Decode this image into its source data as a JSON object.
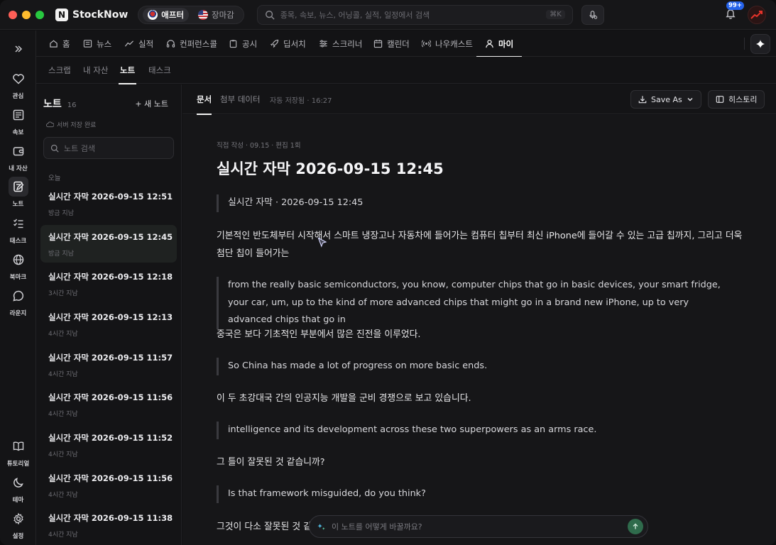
{
  "app": {
    "brand": "StockNow",
    "logo_letter": "N",
    "markets": [
      {
        "label": "애프터",
        "flag": "kr-flag-icon",
        "active": true
      },
      {
        "label": "장마감",
        "flag": "us-flag-icon",
        "active": false
      }
    ],
    "search": {
      "placeholder": "종목, 속보, 뉴스, 어닝콜, 실적, 일정에서 검색",
      "shortcut": "⌘K"
    },
    "notification_badge": "99+"
  },
  "rail": [
    {
      "label": "관심",
      "icon": "heart-icon"
    },
    {
      "label": "속보",
      "icon": "newspaper-icon"
    },
    {
      "label": "내 자산",
      "icon": "wallet-icon"
    },
    {
      "label": "노트",
      "icon": "note-edit-icon",
      "active": true
    },
    {
      "label": "태스크",
      "icon": "checklist-icon"
    },
    {
      "label": "북마크",
      "icon": "globe-icon"
    },
    {
      "label": "라운지",
      "icon": "chat-icon"
    },
    {
      "label": "튜토리얼",
      "icon": "book-icon"
    },
    {
      "label": "테마",
      "icon": "moon-icon"
    },
    {
      "label": "설정",
      "icon": "gear-icon"
    }
  ],
  "topnav": [
    {
      "label": "홈",
      "icon": "home-icon"
    },
    {
      "label": "뉴스",
      "icon": "news-icon"
    },
    {
      "label": "실적",
      "icon": "trend-icon"
    },
    {
      "label": "컨퍼런스콜",
      "icon": "headphones-icon"
    },
    {
      "label": "공시",
      "icon": "clipboard-icon"
    },
    {
      "label": "딥서치",
      "icon": "rocket-icon"
    },
    {
      "label": "스크리너",
      "icon": "sliders-icon"
    },
    {
      "label": "캘린더",
      "icon": "calendar-icon"
    },
    {
      "label": "나우캐스트",
      "icon": "broadcast-icon"
    },
    {
      "label": "마이",
      "icon": "user-icon",
      "active": true
    }
  ],
  "subnav": [
    {
      "label": "스크랩"
    },
    {
      "label": "내 자산"
    },
    {
      "label": "노트",
      "active": true
    },
    {
      "label": "태스크"
    }
  ],
  "notes": {
    "title": "노트",
    "count": "16",
    "new_label": "+ 새 노트",
    "saved_status": "서버 저장 완료",
    "search_placeholder": "노트 검색",
    "group_label": "오늘",
    "items": [
      {
        "name": "실시간 자막 2026-09-15 12:51",
        "time": "방금 지남"
      },
      {
        "name": "실시간 자막 2026-09-15 12:45",
        "time": "방금 지남",
        "active": true
      },
      {
        "name": "실시간 자막 2026-09-15 12:18",
        "time": "3시간 지남"
      },
      {
        "name": "실시간 자막 2026-09-15 12:13",
        "time": "4시간 지남"
      },
      {
        "name": "실시간 자막 2026-09-15 11:57",
        "time": "4시간 지남"
      },
      {
        "name": "실시간 자막 2026-09-15 11:56",
        "time": "4시간 지남"
      },
      {
        "name": "실시간 자막 2026-09-15 11:52",
        "time": "4시간 지남"
      },
      {
        "name": "실시간 자막 2026-09-15 11:56",
        "time": "4시간 지남"
      },
      {
        "name": "실시간 자막 2026-09-15 11:38",
        "time": "4시간 지남"
      }
    ]
  },
  "doc": {
    "tabs": [
      {
        "label": "문서",
        "active": true
      },
      {
        "label": "첨부 데이터"
      }
    ],
    "autosave": "자동 저장됨 · 16:27",
    "save_as": "Save As",
    "history": "히스토리",
    "meta": "직접 작성 · 09.15 · 편집 1회",
    "title": "실시간 자막 2026-09-15 12:45",
    "header_quote": "실시간 자막 · 2026-09-15 12:45",
    "p1": "기본적인 반도체부터 시작해서 스마트 냉장고나 자동차에 들어가는 컴퓨터 칩부터 최신 iPhone에 들어갈 수 있는 고급 칩까지, 그리고 더욱 첨단 칩이 들어가는",
    "q1": "from the really basic semiconductors, you know, computer chips that go in basic devices, your smart fridge, your car, um, up to the kind of more advanced chips that might go in a brand new iPhone, up to very advanced chips that go in",
    "p2": "중국은 보다 기초적인 부분에서 많은 진전을 이루었다.",
    "q2": "So China has made a lot of progress on more basic ends.",
    "p3": "이 두 초강대국 간의 인공지능 개발을 군비 경쟁으로 보고 있습니다.",
    "q3": "intelligence and its development across these two superpowers as an arms race.",
    "p4": "그 틀이 잘못된 것 같습니까?",
    "q4": "Is that framework misguided, do you think?",
    "p5": "그것이 다소 잘못된 것 같"
  },
  "prompt": {
    "placeholder": "이 노트를 어떻게 바꿀까요?"
  }
}
